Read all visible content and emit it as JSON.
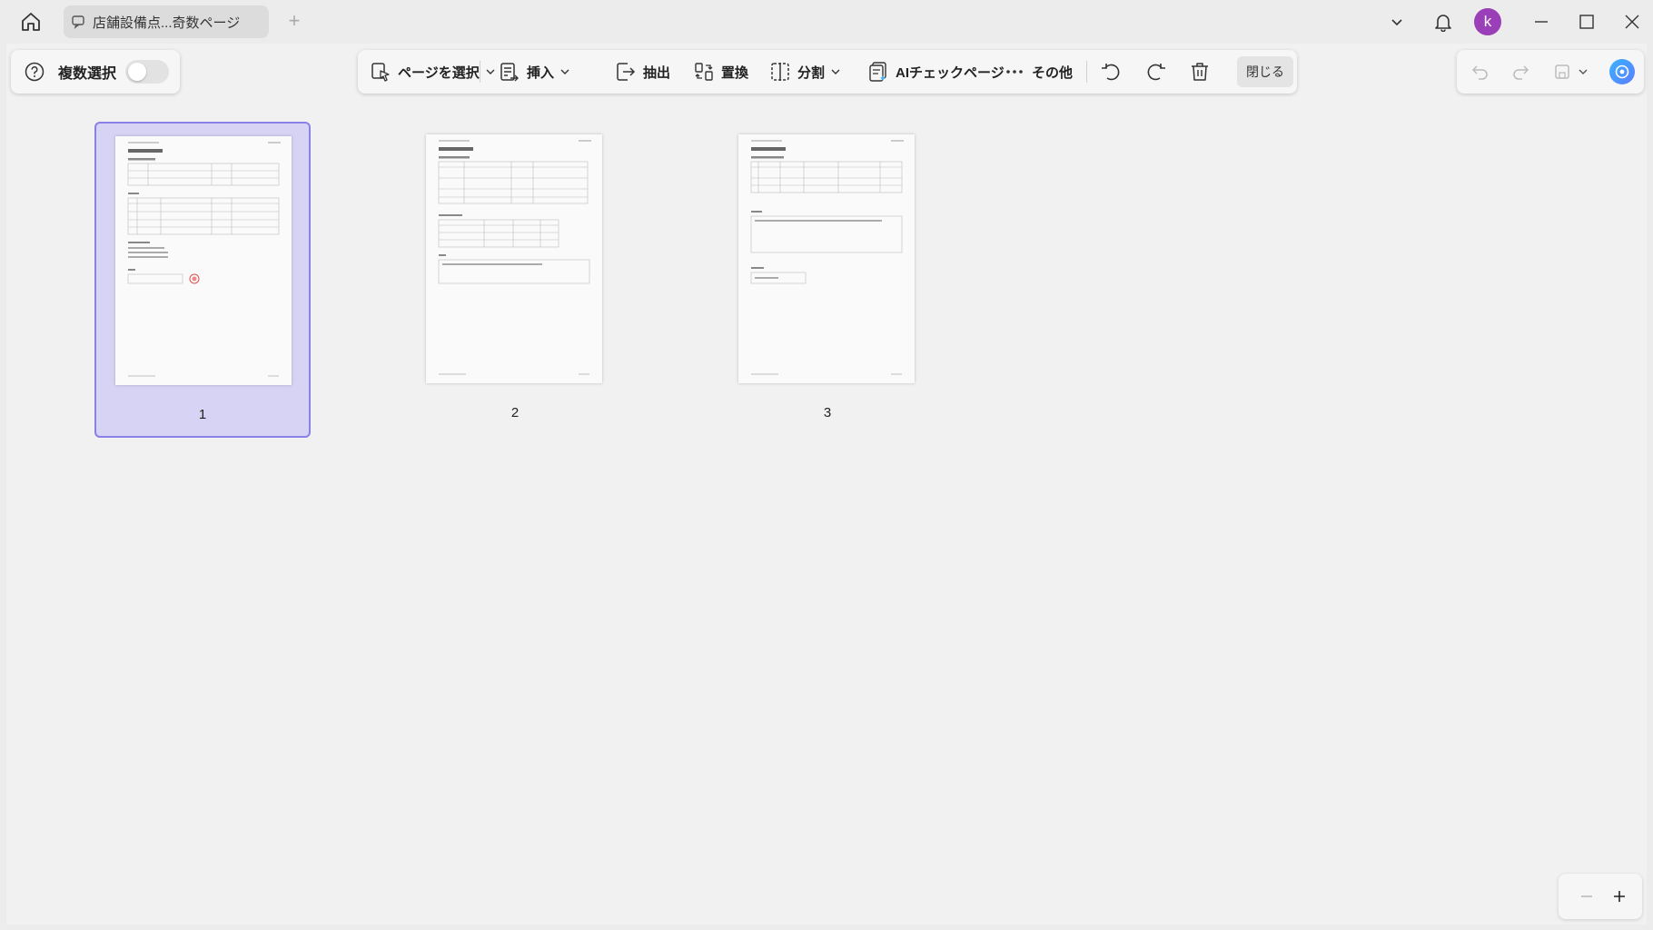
{
  "tab": {
    "title": "店舗設備点...奇数ページ"
  },
  "user": {
    "initial": "k"
  },
  "left_panel": {
    "multi_select_label": "複数選択",
    "multi_select_on": false
  },
  "toolbar": {
    "select_pages": "ページを選択",
    "insert": "挿入",
    "extract": "抽出",
    "replace": "置換",
    "split": "分割",
    "ai_check": "AIチェックページ",
    "more": "その他",
    "close": "閉じる"
  },
  "pages": [
    {
      "label": "1",
      "selected": true
    },
    {
      "label": "2",
      "selected": false
    },
    {
      "label": "3",
      "selected": false
    }
  ],
  "colors": {
    "selection_bg": "#d6d3f4",
    "selection_border": "#8a80e6",
    "avatar": "#9a3fb8",
    "ai_badge": "#3ab2ff"
  },
  "icons": [
    "home-icon",
    "doc-tab-icon",
    "plus-icon",
    "chevron-down-icon",
    "bell-icon",
    "minimize-icon",
    "maximize-icon",
    "close-icon",
    "help-icon",
    "select-pages-icon",
    "insert-icon",
    "extract-icon",
    "replace-icon",
    "split-icon",
    "ai-check-icon",
    "more-dots-icon",
    "rotate-left-icon",
    "rotate-right-icon",
    "trash-icon",
    "undo-icon",
    "redo-icon",
    "save-icon",
    "ai-assistant-icon",
    "zoom-out-icon",
    "zoom-in-icon"
  ]
}
